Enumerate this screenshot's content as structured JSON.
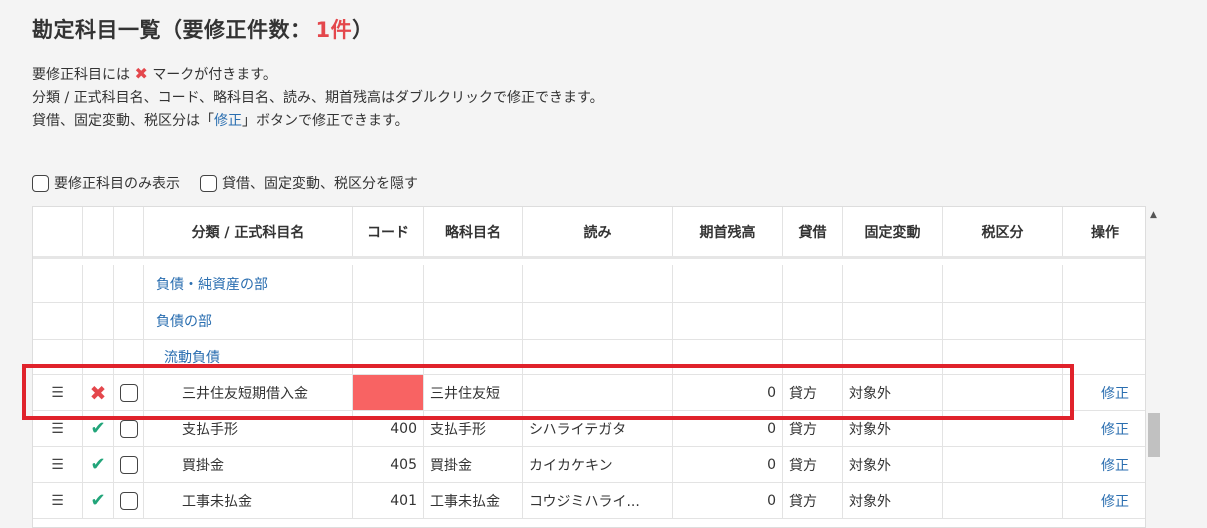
{
  "page": {
    "title_main": "勘定科目一覧（要修正件数：",
    "title_count": "1件",
    "title_end": "）"
  },
  "description": {
    "line1_before": "要修正科目には",
    "line1_mark": "✖",
    "line1_after": "マークが付きます。",
    "line2": "分類 / 正式科目名、コード、略科目名、読み、期首残高はダブルクリックで修正できます。",
    "line3_before": "貸借、固定変動、税区分は「",
    "line3_link": "修正",
    "line3_after": "」ボタンで修正できます。"
  },
  "filters": {
    "only_needs_fix": "要修正科目のみ表示",
    "hide_columns": "貸借、固定変動、税区分を隠す"
  },
  "table": {
    "headers": {
      "category": "分類 / 正式科目名",
      "code": "コード",
      "short_name": "略科目名",
      "reading": "読み",
      "opening_balance": "期首残高",
      "debit_credit": "貸借",
      "fixed_variable": "固定変動",
      "tax": "税区分",
      "action": "操作"
    },
    "groups": [
      {
        "label": "負債・純資産の部"
      },
      {
        "label": "負債の部"
      },
      {
        "label": "流動負債"
      }
    ],
    "rows": [
      {
        "handle": "☰",
        "status": "✖",
        "name": "三井住友短期借入金",
        "code": "",
        "short": "三井住友短",
        "reading": "",
        "balance": "0",
        "dc": "貸方",
        "fv": "対象外",
        "tax": "",
        "action": "修正"
      },
      {
        "handle": "☰",
        "status": "✔",
        "name": "支払手形",
        "code": "400",
        "short": "支払手形",
        "reading": "シハライテガタ",
        "balance": "0",
        "dc": "貸方",
        "fv": "対象外",
        "tax": "",
        "action": "修正"
      },
      {
        "handle": "☰",
        "status": "✔",
        "name": "買掛金",
        "code": "405",
        "short": "買掛金",
        "reading": "カイカケキン",
        "balance": "0",
        "dc": "貸方",
        "fv": "対象外",
        "tax": "",
        "action": "修正"
      },
      {
        "handle": "☰",
        "status": "✔",
        "name": "工事未払金",
        "code": "401",
        "short": "工事未払金",
        "reading": "コウジミハライ...",
        "balance": "0",
        "dc": "貸方",
        "fv": "対象外",
        "tax": "",
        "action": "修正"
      }
    ]
  },
  "colors": {
    "error": "#e4474c",
    "ok": "#22a57a",
    "link": "#2a6eb0",
    "highlight": "#e0222b"
  }
}
